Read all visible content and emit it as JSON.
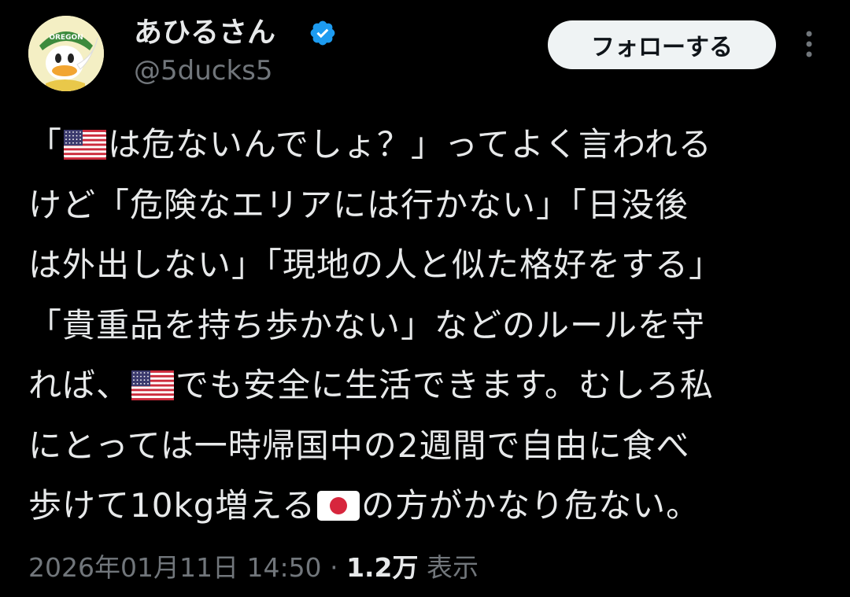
{
  "author": {
    "display_name": "あひるさん",
    "handle": "@5ducks5",
    "avatar_badge_text": "OREGON",
    "verified": true,
    "verified_color": "#1d9bf0"
  },
  "actions": {
    "follow_label": "フォローする",
    "more_icon": "more-vertical-icon"
  },
  "tweet": {
    "segments": [
      {
        "text": "「"
      },
      {
        "flag": "us"
      },
      {
        "text": "は危ないんでしょ？」ってよく言われる"
      },
      {
        "break": true
      },
      {
        "text": "けど「危険なエリアには行かない」「日没後"
      },
      {
        "break": true
      },
      {
        "text": "は外出しない」「現地の人と似た格好をする」"
      },
      {
        "break": true
      },
      {
        "text": "「貴重品を持ち歩かない」などのルールを守"
      },
      {
        "break": true
      },
      {
        "text": "れば、"
      },
      {
        "flag": "us"
      },
      {
        "text": "でも安全に生活できます。むしろ私"
      },
      {
        "break": true
      },
      {
        "text": "にとっては一時帰国中の2週間で自由に食べ"
      },
      {
        "break": true
      },
      {
        "text": "歩けて10kg増える"
      },
      {
        "flag": "jp"
      },
      {
        "text": "の方がかなり危ない。"
      }
    ]
  },
  "meta": {
    "timestamp": "2026年01月11日 14:50",
    "separator": "·",
    "views_count": "1.2万",
    "views_label": "表示"
  },
  "colors": {
    "background": "#000000",
    "text_primary": "#e7e9ea",
    "text_secondary": "#71767b",
    "follow_button_bg": "#eff3f4"
  }
}
